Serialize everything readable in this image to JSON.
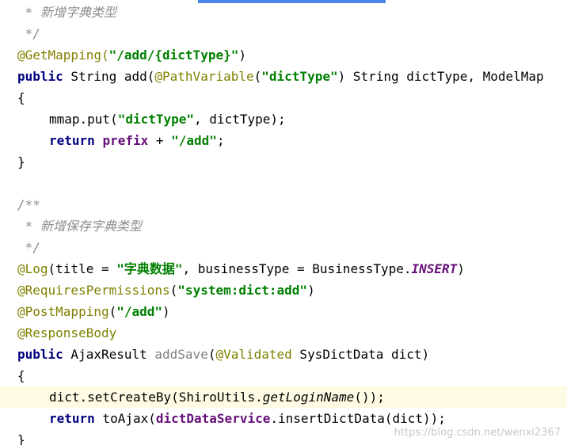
{
  "editor": {
    "lines": {
      "l1": {
        "a": " * 新增字典类型"
      },
      "l2": {
        "a": " */"
      },
      "l3": {
        "a": "@GetMapping(",
        "b": "\"/add/{dictType}\"",
        "c": ")"
      },
      "l4": {
        "a": "public",
        "b": " String add(",
        "c": "@PathVariable",
        "d": "(",
        "e": "\"dictType\"",
        "f": ") String dictType, ModelMap"
      },
      "l5": {
        "a": "{"
      },
      "l6": {
        "a": "mmap.put(",
        "b": "\"dictType\"",
        "c": ", dictType);"
      },
      "l7": {
        "a": "return",
        "b": " ",
        "c": "prefix",
        "d": " + ",
        "e": "\"/add\"",
        "f": ";"
      },
      "l8": {
        "a": "}"
      },
      "l10": {
        "a": "/**"
      },
      "l11": {
        "a": " * 新增保存字典类型"
      },
      "l12": {
        "a": " */"
      },
      "l13": {
        "a": "@Log",
        "b": "(title = ",
        "c": "\"字典数据\"",
        "d": ", businessType = BusinessType.",
        "e": "INSERT",
        "f": ")"
      },
      "l14": {
        "a": "@RequiresPermissions",
        "b": "(",
        "c": "\"system:dict:add\"",
        "d": ")"
      },
      "l15": {
        "a": "@PostMapping",
        "b": "(",
        "c": "\"/add\"",
        "d": ")"
      },
      "l16": {
        "a": "@ResponseBody"
      },
      "l17": {
        "a": "public",
        "b": " AjaxResult ",
        "c": "addSave",
        "d": "(",
        "e": "@Validated",
        "f": " SysDictData dict)"
      },
      "l18": {
        "a": "{"
      },
      "l19": {
        "a": "dict.setCreateBy(ShiroUtils.",
        "b": "getLoginName",
        "c": "());"
      },
      "l20": {
        "a": "return",
        "b": " toAjax(",
        "c": "dictDataService",
        "d": ".insertDictData(dict));"
      },
      "l21": {
        "a": "}"
      }
    }
  },
  "watermark": "https://blog.csdn.net/wenxi2367",
  "colors": {
    "keyword": "#000080",
    "string": "#008000",
    "annotation": "#808000",
    "comment": "#8c8c8c",
    "field": "#660e7a",
    "highlight_line": "#fffae3",
    "tab_indicator": "#4a86e8"
  }
}
